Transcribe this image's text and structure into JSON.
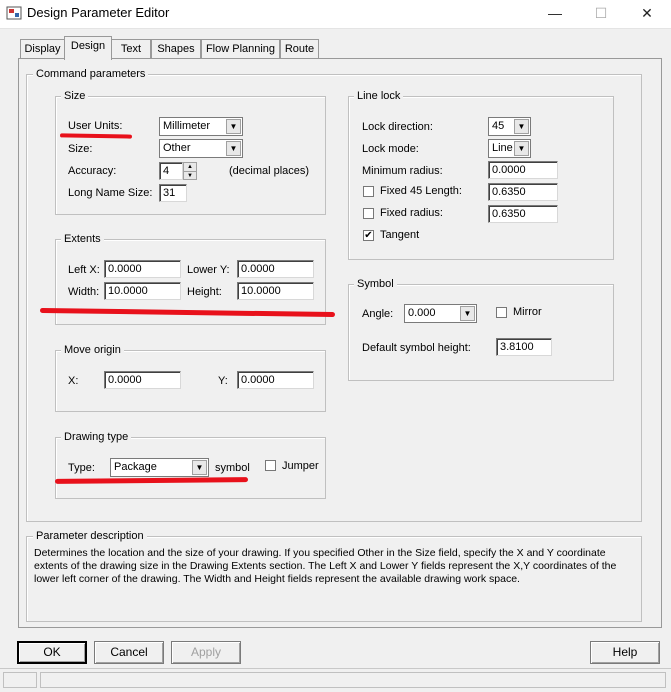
{
  "window": {
    "title": "Design Parameter Editor",
    "minimize_glyph": "—",
    "maximize_glyph": "☐",
    "close_glyph": "✕"
  },
  "tabs": [
    {
      "label": "Display"
    },
    {
      "label": "Design"
    },
    {
      "label": "Text"
    },
    {
      "label": "Shapes"
    },
    {
      "label": "Flow Planning"
    },
    {
      "label": "Route"
    }
  ],
  "active_tab": "Design",
  "command_parameters": {
    "title": "Command parameters",
    "size": {
      "title": "Size",
      "user_units_label": "User Units:",
      "user_units_value": "Millimeter",
      "size_label": "Size:",
      "size_value": "Other",
      "accuracy_label": "Accuracy:",
      "accuracy_value": "4",
      "accuracy_hint": "(decimal places)",
      "long_name_label": "Long Name Size:",
      "long_name_value": "31"
    },
    "extents": {
      "title": "Extents",
      "left_x_label": "Left X:",
      "left_x_value": "0.0000",
      "lower_y_label": "Lower Y:",
      "lower_y_value": "0.0000",
      "width_label": "Width:",
      "width_value": "10.0000",
      "height_label": "Height:",
      "height_value": "10.0000"
    },
    "move_origin": {
      "title": "Move origin",
      "x_label": "X:",
      "x_value": "0.0000",
      "y_label": "Y:",
      "y_value": "0.0000"
    },
    "drawing_type": {
      "title": "Drawing type",
      "type_label": "Type:",
      "type_value": "Package",
      "suffix": "symbol",
      "jumper_label": "Jumper",
      "jumper_checked": false
    },
    "line_lock": {
      "title": "Line lock",
      "direction_label": "Lock direction:",
      "direction_value": "45",
      "mode_label": "Lock mode:",
      "mode_value": "Line",
      "min_radius_label": "Minimum radius:",
      "min_radius_value": "0.0000",
      "fixed45_label": "Fixed 45 Length:",
      "fixed45_value": "0.6350",
      "fixed45_checked": false,
      "fixed_radius_label": "Fixed radius:",
      "fixed_radius_value": "0.6350",
      "fixed_radius_checked": false,
      "tangent_label": "Tangent",
      "tangent_checked": true
    },
    "symbol": {
      "title": "Symbol",
      "angle_label": "Angle:",
      "angle_value": "0.000",
      "mirror_label": "Mirror",
      "mirror_checked": false,
      "height_label": "Default symbol height:",
      "height_value": "3.8100"
    }
  },
  "parameter_description": {
    "title": "Parameter description",
    "text": "Determines the location and the size of your drawing.  If you specified Other in the Size field, specify the X and Y coordinate extents of the drawing size in the Drawing Extents section. The Left X and Lower Y fields represent the X,Y coordinates of the lower left corner of the drawing.  The Width and Height fields represent the available drawing work space."
  },
  "buttons": {
    "ok": "OK",
    "cancel": "Cancel",
    "apply": "Apply",
    "help": "Help"
  },
  "icons": {
    "dropdown": "▼",
    "spin_up": "▲",
    "spin_down": "▼",
    "check": "✔"
  },
  "annotation_color": "#e8111b"
}
